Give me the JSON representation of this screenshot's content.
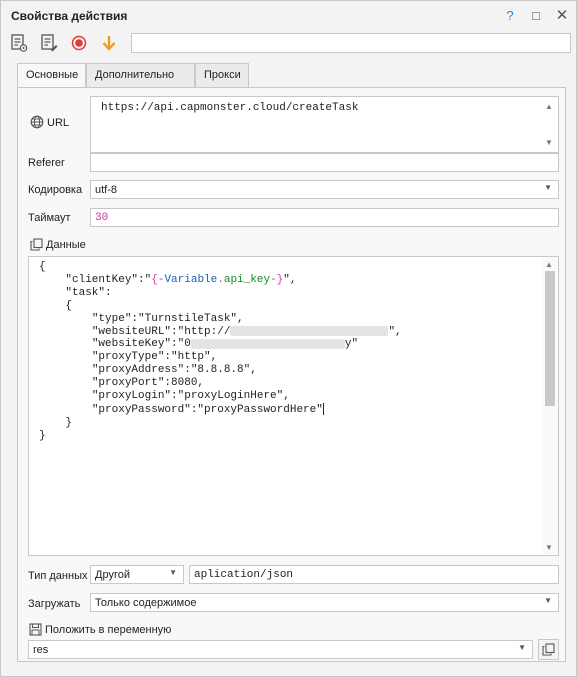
{
  "window": {
    "title": "Свойства действия",
    "help": "?",
    "minimize": "□",
    "close": "✕"
  },
  "toolbar": {
    "search_value": ""
  },
  "tabs": [
    "Основные",
    "Дополнительно",
    "Прокси"
  ],
  "url": {
    "label": "URL",
    "value": "https://api.capmonster.cloud/createTask"
  },
  "referer": {
    "label": "Referer",
    "value": ""
  },
  "encoding": {
    "label": "Кодировка",
    "value": "utf-8"
  },
  "timeout": {
    "label": "Таймаут",
    "value": "30"
  },
  "data": {
    "label": "Данные",
    "line1": "{",
    "client_key_key": "\"clientKey\":\"",
    "var_open": "{-",
    "var_ns": "Variable",
    "var_dot": ".",
    "var_name": "api_key",
    "var_close": "-}",
    "client_key_end": "\",",
    "task_key": "\"task\":",
    "task_open": "{",
    "type_line": "\"type\":\"TurnstileTask\",",
    "website_url_start": "\"websiteURL\":\"http://",
    "website_url_end": "\",",
    "website_key_start": "\"websiteKey\":\"0",
    "website_key_end": "y\"",
    "proxy_type_line": "\"proxyType\":\"http\",",
    "proxy_address_line": "\"proxyAddress\":\"8.8.8.8\",",
    "proxy_port_line": "\"proxyPort\":8080,",
    "proxy_login_line": "\"proxyLogin\":\"proxyLoginHere\",",
    "proxy_password_line": "\"proxyPassword\":\"proxyPasswordHere\"",
    "task_close": "}",
    "line_end": "}"
  },
  "data_type": {
    "label": "Тип данных",
    "value": "Другой",
    "content_type": "aplication/json"
  },
  "load": {
    "label": "Загружать",
    "value": "Только содержимое"
  },
  "save_to_var": {
    "label": "Положить в переменную",
    "value": "res"
  }
}
